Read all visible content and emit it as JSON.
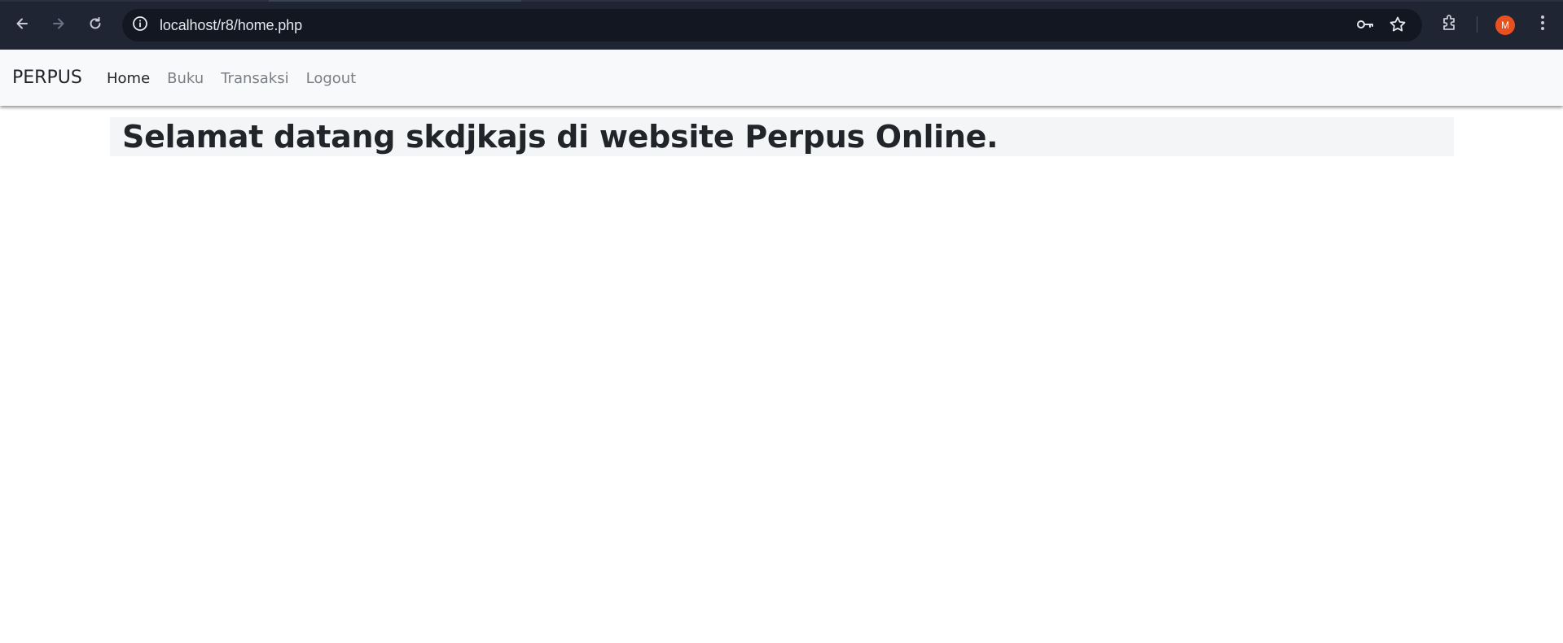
{
  "browser": {
    "url": "localhost/r8/home.php",
    "profile_initial": "M",
    "icons": {
      "back": "arrow-left-icon",
      "forward": "arrow-right-icon",
      "reload": "reload-icon",
      "site_info": "info-icon",
      "passwords": "key-icon",
      "bookmark": "star-icon",
      "extensions": "puzzle-icon",
      "menu": "kebab-menu-icon"
    },
    "colors": {
      "toolbar": "#202533",
      "omnibox": "#131722",
      "avatar": "#e8501f"
    }
  },
  "navbar": {
    "brand": "PERPUS",
    "links": [
      {
        "label": "Home",
        "active": true
      },
      {
        "label": "Buku",
        "active": false
      },
      {
        "label": "Transaksi",
        "active": false
      },
      {
        "label": "Logout",
        "active": false
      }
    ]
  },
  "main": {
    "heading": "Selamat datang skdjkajs di website Perpus Online."
  }
}
